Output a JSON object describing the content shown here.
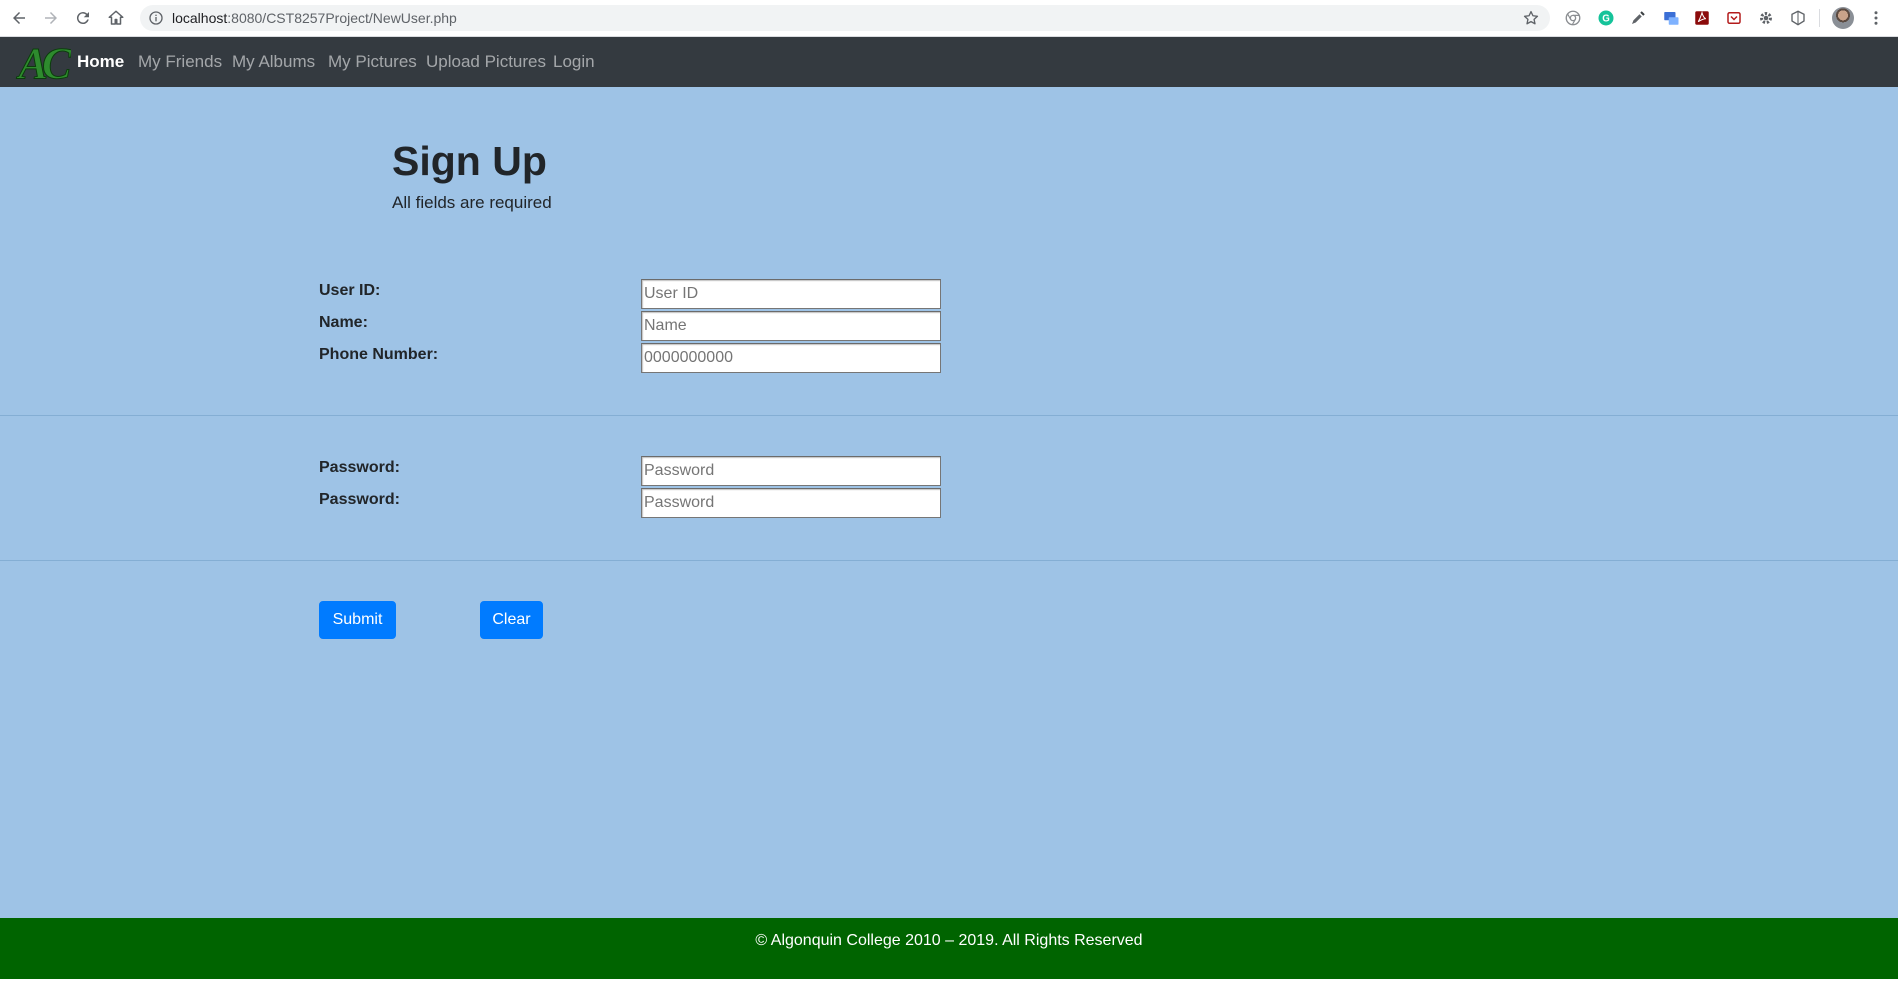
{
  "browser": {
    "url_host": "localhost",
    "url_rest": ":8080/CST8257Project/NewUser.php",
    "icons": [
      "back-icon",
      "forward-icon",
      "reload-icon",
      "home-icon",
      "info-icon",
      "bookmark-star-icon",
      "menu-icon"
    ],
    "extensions": [
      "chrome-extension-icon",
      "grammarly-icon",
      "eyedropper-icon",
      "screenshot-extension-icon",
      "pdf-icon",
      "pocket-icon",
      "gear-extension-icon",
      "shield-extension-icon"
    ]
  },
  "nav": {
    "logo_text": "AC",
    "home": "Home",
    "friends": "My Friends",
    "albums": "My Albums",
    "pictures": "My Pictures",
    "upload": "Upload Pictures",
    "login": "Login"
  },
  "page": {
    "title": "Sign Up",
    "subtitle": "All fields are required"
  },
  "form": {
    "user_id_label": "User ID:",
    "user_id_placeholder": "User ID",
    "name_label": "Name:",
    "name_placeholder": "Name",
    "phone_label": "Phone Number:",
    "phone_placeholder": "0000000000",
    "password_label": "Password:",
    "password_placeholder": "Password",
    "password2_label": "Password:",
    "password2_placeholder": "Password",
    "submit_label": "Submit",
    "clear_label": "Clear"
  },
  "footer": {
    "text": "© Algonquin College 2010 – 2019. All Rights Reserved"
  },
  "colors": {
    "page_bg": "#9ec3e6",
    "navbar_bg": "#343a40",
    "footer_bg": "#006400",
    "button_bg": "#007bff",
    "logo_green": "#2e8b2e"
  }
}
